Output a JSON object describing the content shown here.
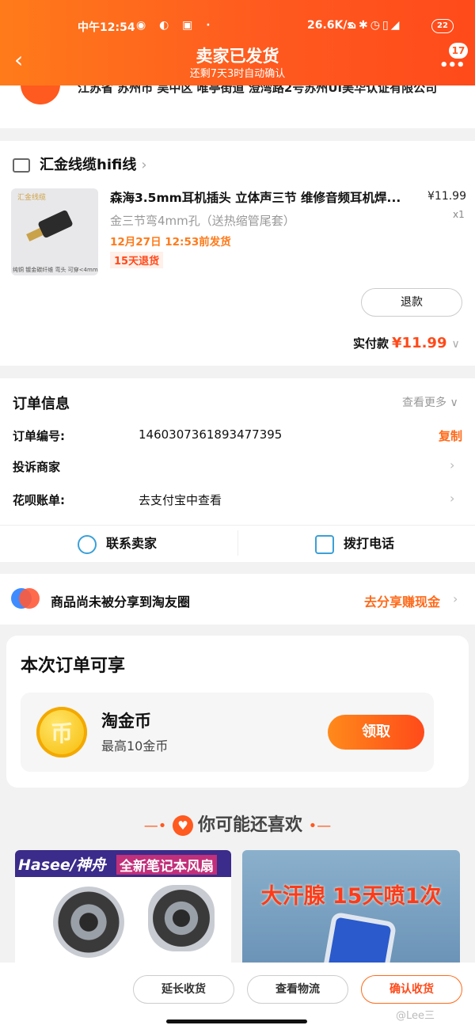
{
  "status_bar": {
    "time": "中午12:54",
    "network_speed": "26.6K/s",
    "battery": "22"
  },
  "header": {
    "back_icon": "chevron-left-icon",
    "title": "卖家已发货",
    "subtitle": "还剩7天3时自动确认",
    "badge_count": "17",
    "accent": "#ff5a1f"
  },
  "address": {
    "text": "江苏省 苏州市 吴中区 唯亭街道 澄湾路2号苏州UI美华认证有限公司"
  },
  "shop": {
    "name": "汇金线缆hifi线"
  },
  "product": {
    "thumb_brand": "汇金线缆",
    "thumb_caption": "纯铜 镀金碳纤维 弯头 可穿<4mm",
    "name": "森海3.5mm耳机插头 立体声三节 维修音频耳机焊...",
    "price": "¥11.99",
    "qty": "x1",
    "spec": "金三节弯4mm孔（送热缩管尾套）",
    "ship_note": "12月27日 12:53前发货",
    "return_tag": "15天退货",
    "refund_label": "退款",
    "paid_label": "实付款",
    "paid_amount": "¥11.99"
  },
  "order_info": {
    "title": "订单信息",
    "more": "查看更多",
    "order_no_label": "订单编号:",
    "order_no": "1460307361893477395",
    "copy_label": "复制",
    "complain_label": "投诉商家",
    "huabei_label": "花呗账单:",
    "huabei_value": "去支付宝中查看",
    "contact_seller": "联系卖家",
    "call_phone": "拨打电话"
  },
  "share": {
    "text": "商品尚未被分享到淘友圈",
    "cta": "去分享赚现金"
  },
  "benefit": {
    "title": "本次订单可享",
    "coin_symbol": "币",
    "name": "淘金币",
    "desc": "最高10金币",
    "claim": "领取"
  },
  "recommend": {
    "title": "你可能还喜欢",
    "item1_brand": "Hasee/神舟",
    "item1_tag": "全新笔记本风扇",
    "item2_text": "大汗腺 15天喷1次"
  },
  "bottom_bar": {
    "extend": "延长收货",
    "logistics": "查看物流",
    "confirm": "确认收货",
    "watermark": "@Lee三"
  }
}
